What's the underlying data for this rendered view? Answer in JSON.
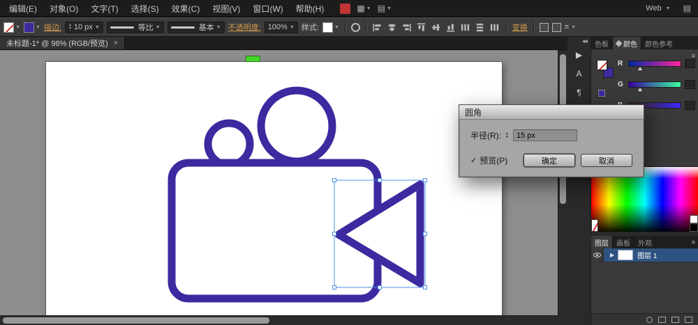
{
  "colors": {
    "artwork_stroke": "#3b2aa0",
    "selection": "#4a8fe2",
    "link_orange": "#d39a4d",
    "layer_selected_bg": "#2f5380",
    "green_tag": "#44d62c"
  },
  "icons": {
    "dropdown": "▼",
    "close": "×",
    "collapse_left": "◀◀",
    "check": "✓",
    "panel_menu": "≡",
    "expand": "▶",
    "character": "A",
    "paragraph": "¶",
    "spin_up": "▲",
    "spin_down": "▼",
    "grid": "▦",
    "rows": "▤"
  },
  "menubar": {
    "items": [
      "编辑(E)",
      "对象(O)",
      "文字(T)",
      "选择(S)",
      "效果(C)",
      "视图(V)",
      "窗口(W)",
      "帮助(H)"
    ],
    "workspace": "Web"
  },
  "controlbar": {
    "stroke_link": "描边:",
    "stroke_width": "10 px",
    "profile": "等比",
    "brush": "基本",
    "opacity_link": "不透明度:",
    "opacity_value": "100%",
    "style_label": "样式:",
    "transform_link": "变换"
  },
  "tabbar": {
    "title": "未标题-1* @ 98% (RGB/预览)"
  },
  "dialog": {
    "title": "圆角",
    "radius_label": "半径(R):",
    "radius_value": "15 px",
    "preview_label": "预览(P)",
    "ok": "确定",
    "cancel": "取消"
  },
  "panels": {
    "color_tabs": [
      "色板",
      "颜色",
      "颜色参考"
    ],
    "channels": [
      "R",
      "G",
      "B"
    ],
    "layers_tabs": [
      "图层",
      "画板",
      "外观"
    ],
    "layer_name": "图层 1"
  }
}
